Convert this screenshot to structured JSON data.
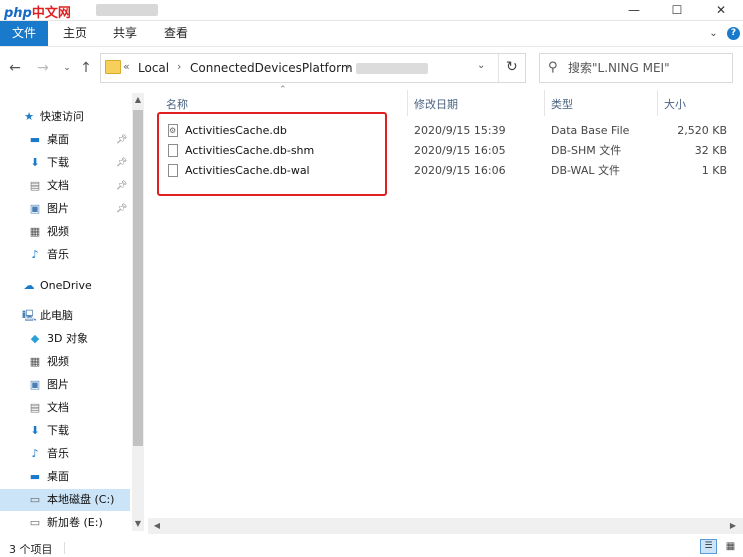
{
  "titlebar": {
    "logo_latin": "php",
    "logo_cn": "中文网",
    "minimize": "—",
    "maximize": "☐",
    "close": "✕"
  },
  "ribbon": {
    "tabs": [
      "文件",
      "主页",
      "共享",
      "查看"
    ],
    "expand_icon": "chevron-down-icon",
    "help_icon": "help-icon"
  },
  "address": {
    "crumbs": [
      "Local",
      "ConnectedDevicesPlatform"
    ],
    "overflow": "«",
    "separator": "›"
  },
  "search": {
    "placeholder": "搜索\"L.NING MEI\""
  },
  "sidebar": {
    "quick_access": {
      "label": "快速访问",
      "icon": "star-icon"
    },
    "quick_items": [
      {
        "label": "桌面",
        "icon": "desktop-icon",
        "pinned": true
      },
      {
        "label": "下载",
        "icon": "download-icon",
        "pinned": true
      },
      {
        "label": "文档",
        "icon": "document-icon",
        "pinned": true
      },
      {
        "label": "图片",
        "icon": "picture-icon",
        "pinned": true
      },
      {
        "label": "视频",
        "icon": "video-icon",
        "pinned": false
      },
      {
        "label": "音乐",
        "icon": "music-icon",
        "pinned": false
      }
    ],
    "onedrive": {
      "label": "OneDrive",
      "icon": "cloud-icon"
    },
    "this_pc": {
      "label": "此电脑",
      "icon": "computer-icon"
    },
    "pc_items": [
      {
        "label": "3D 对象",
        "icon": "cube-icon"
      },
      {
        "label": "视频",
        "icon": "video-icon"
      },
      {
        "label": "图片",
        "icon": "picture-icon"
      },
      {
        "label": "文档",
        "icon": "document-icon"
      },
      {
        "label": "下载",
        "icon": "download-icon"
      },
      {
        "label": "音乐",
        "icon": "music-icon"
      },
      {
        "label": "桌面",
        "icon": "desktop-icon"
      },
      {
        "label": "本地磁盘 (C:)",
        "icon": "drive-icon",
        "selected": true
      },
      {
        "label": "新加卷 (E:)",
        "icon": "drive-icon"
      }
    ]
  },
  "columns": {
    "name": "名称",
    "modified": "修改日期",
    "type": "类型",
    "size": "大小"
  },
  "files": [
    {
      "name": "ActivitiesCache.db",
      "modified": "2020/9/15 15:39",
      "type": "Data Base File",
      "size": "2,520 KB",
      "icon": "database-file-icon"
    },
    {
      "name": "ActivitiesCache.db-shm",
      "modified": "2020/9/15 16:05",
      "type": "DB-SHM 文件",
      "size": "32 KB",
      "icon": "file-icon"
    },
    {
      "name": "ActivitiesCache.db-wal",
      "modified": "2020/9/15 16:06",
      "type": "DB-WAL 文件",
      "size": "1 KB",
      "icon": "file-icon"
    }
  ],
  "status": {
    "count": "3 个项目"
  },
  "colors": {
    "accent": "#1979ca",
    "highlight": "#e02020",
    "selected_bg": "#cce4f7"
  }
}
